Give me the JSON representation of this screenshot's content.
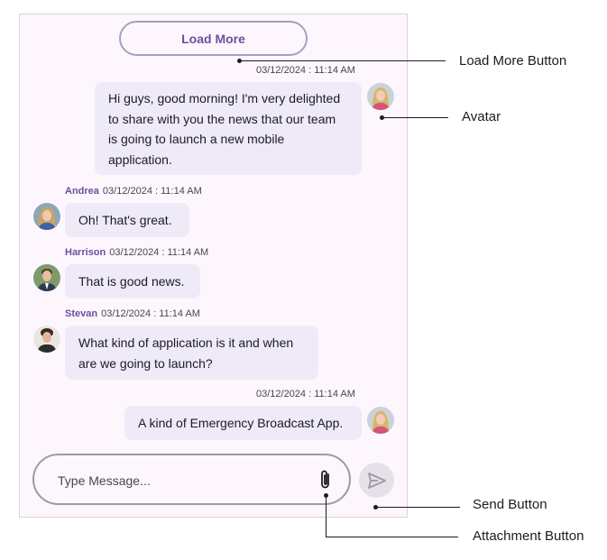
{
  "load_more_label": "Load More",
  "messages": [
    {
      "time": "03/12/2024 : 11:14 AM",
      "text": "Hi guys, good morning! I'm very delighted to share with you the news that our team is going to launch a new mobile application."
    },
    {
      "author": "Andrea",
      "time": "03/12/2024 : 11:14 AM",
      "text": "Oh! That's great."
    },
    {
      "author": "Harrison",
      "time": "03/12/2024 : 11:14 AM",
      "text": "That is good news."
    },
    {
      "author": "Stevan",
      "time": "03/12/2024 : 11:14 AM",
      "text": "What kind of application is it and when are we going to launch?"
    },
    {
      "time": "03/12/2024 : 11:14 AM",
      "text": "A kind of Emergency Broadcast App."
    }
  ],
  "composer": {
    "placeholder": "Type Message...",
    "attach_icon": "paperclip-icon",
    "send_icon": "send-icon"
  },
  "callouts": {
    "load_more": "Load More Button",
    "avatar": "Avatar",
    "send": "Send Button",
    "attachment": "Attachment Button"
  },
  "colors": {
    "accent": "#6b4fa0",
    "bubble": "#efeaf8",
    "panel": "#fdf7fd"
  }
}
